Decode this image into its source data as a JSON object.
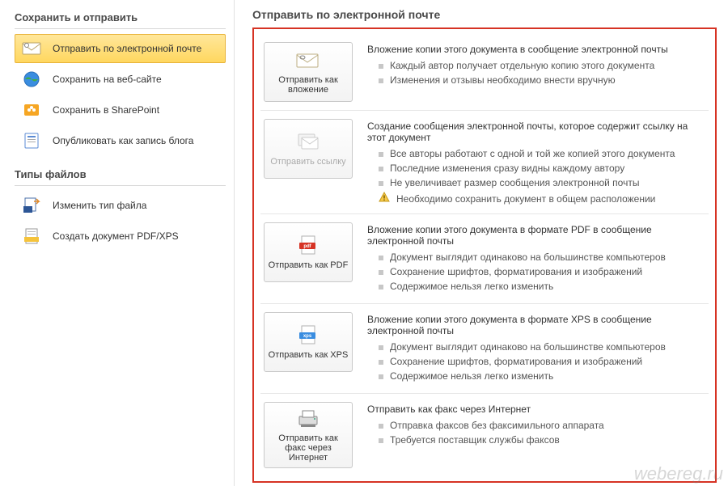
{
  "sidebar": {
    "section1_title": "Сохранить и отправить",
    "items1": [
      {
        "label": "Отправить по электронной почте"
      },
      {
        "label": "Сохранить на веб-сайте"
      },
      {
        "label": "Сохранить в SharePoint"
      },
      {
        "label": "Опубликовать как запись блога"
      }
    ],
    "section2_title": "Типы файлов",
    "items2": [
      {
        "label": "Изменить тип файла"
      },
      {
        "label": "Создать документ PDF/XPS"
      }
    ]
  },
  "main": {
    "title": "Отправить по электронной почте",
    "options": [
      {
        "btn": "Отправить как вложение",
        "head": "Вложение копии этого документа в сообщение электронной почты",
        "bullets": [
          "Каждый автор получает отдельную копию этого документа",
          "Изменения и отзывы необходимо внести вручную"
        ]
      },
      {
        "btn": "Отправить ссылку",
        "head": "Создание сообщения электронной почты, которое содержит ссылку на этот документ",
        "bullets": [
          "Все авторы работают с одной и той же копией этого документа",
          "Последние изменения сразу видны каждому автору",
          "Не увеличивает размер сообщения электронной почты"
        ],
        "warn": "Необходимо сохранить документ в общем расположении"
      },
      {
        "btn": "Отправить как PDF",
        "head": "Вложение копии этого документа в формате PDF в сообщение электронной почты",
        "bullets": [
          "Документ выглядит одинаково на большинстве компьютеров",
          "Сохранение шрифтов, форматирования и изображений",
          "Содержимое нельзя легко изменить"
        ]
      },
      {
        "btn": "Отправить как XPS",
        "head": "Вложение копии этого документа в формате XPS в сообщение электронной почты",
        "bullets": [
          "Документ выглядит одинаково на большинстве компьютеров",
          "Сохранение шрифтов, форматирования и изображений",
          "Содержимое нельзя легко изменить"
        ]
      },
      {
        "btn": "Отправить как факс через Интернет",
        "head": "Отправить как факс через Интернет",
        "bullets": [
          "Отправка факсов без факсимильного аппарата",
          "Требуется поставщик службы факсов"
        ]
      }
    ]
  },
  "watermark": "webereg.ru"
}
